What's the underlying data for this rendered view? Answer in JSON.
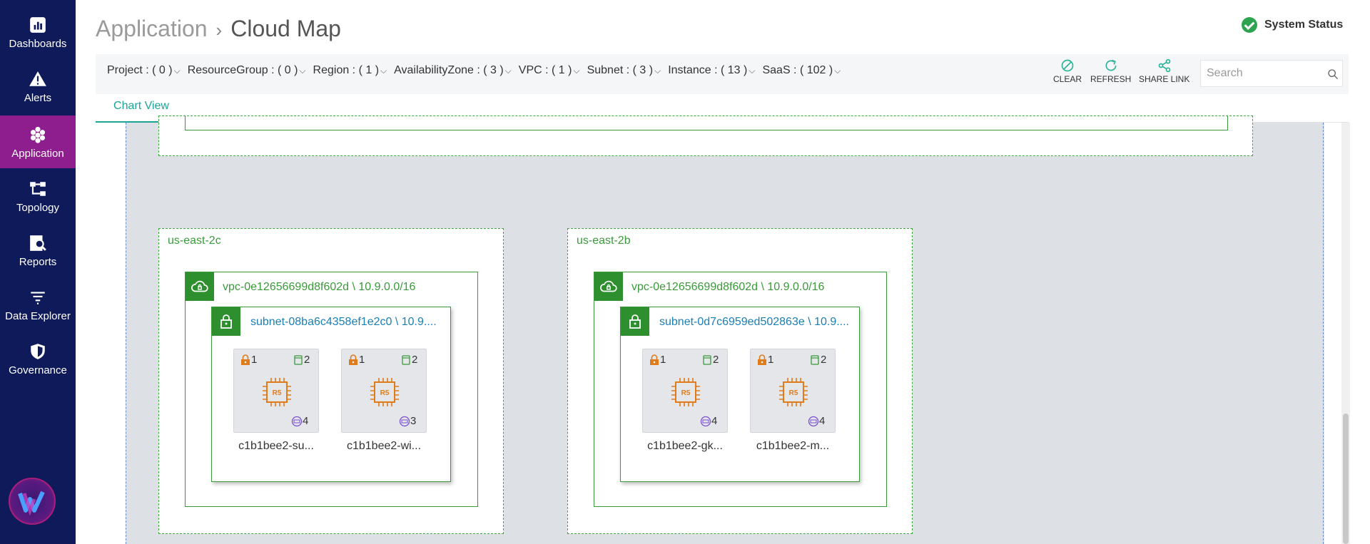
{
  "sidebar": {
    "items": [
      {
        "label": "Dashboards",
        "icon": "bar-chart-icon"
      },
      {
        "label": "Alerts",
        "icon": "warning-icon"
      },
      {
        "label": "Application",
        "icon": "hexagon-cluster-icon",
        "active": true
      },
      {
        "label": "Topology",
        "icon": "topology-icon"
      },
      {
        "label": "Reports",
        "icon": "report-search-icon"
      },
      {
        "label": "Data Explorer",
        "icon": "filter-lines-icon"
      },
      {
        "label": "Governance",
        "icon": "shield-icon"
      }
    ]
  },
  "header": {
    "breadcrumb_root": "Application",
    "breadcrumb_separator": "›",
    "breadcrumb_current": "Cloud Map",
    "system_status": "System Status"
  },
  "filters": [
    "Project : ( 0 )",
    "ResourceGroup : ( 0 )",
    "Region : ( 1 )",
    "AvailabilityZone : ( 3 )",
    "VPC : ( 1 )",
    "Subnet : ( 3 )",
    "Instance : ( 13 )",
    "SaaS : ( 102 )"
  ],
  "actions": {
    "clear": "CLEAR",
    "refresh": "REFRESH",
    "share": "SHARE LINK"
  },
  "search": {
    "placeholder": "Search"
  },
  "tabs": {
    "chart_view": "Chart View"
  },
  "colors": {
    "sidebar_bg": "#0f1a5a",
    "active_nav": "#8e1d8e",
    "accent_teal": "#1aa596",
    "zone_green": "#3a9a3a",
    "subnet_link": "#1a7fb5",
    "instance_orange": "#e07b1a"
  },
  "zones": [
    {
      "label": "us-east-2c",
      "vpc": "vpc-0e12656699d8f602d \\ 10.9.0.0/16",
      "subnet": "subnet-08ba6c4358ef1e2c0 \\ 10.9....",
      "instances": [
        {
          "name": "c1b1bee2-su...",
          "locks": "1",
          "disks": "2",
          "nets": "4",
          "type": "R5"
        },
        {
          "name": "c1b1bee2-wi...",
          "locks": "1",
          "disks": "2",
          "nets": "3",
          "type": "R5"
        }
      ]
    },
    {
      "label": "us-east-2b",
      "vpc": "vpc-0e12656699d8f602d \\ 10.9.0.0/16",
      "subnet": "subnet-0d7c6959ed502863e \\ 10.9....",
      "instances": [
        {
          "name": "c1b1bee2-gk...",
          "locks": "1",
          "disks": "2",
          "nets": "4",
          "type": "R5"
        },
        {
          "name": "c1b1bee2-m...",
          "locks": "1",
          "disks": "2",
          "nets": "4",
          "type": "R5"
        }
      ]
    }
  ]
}
